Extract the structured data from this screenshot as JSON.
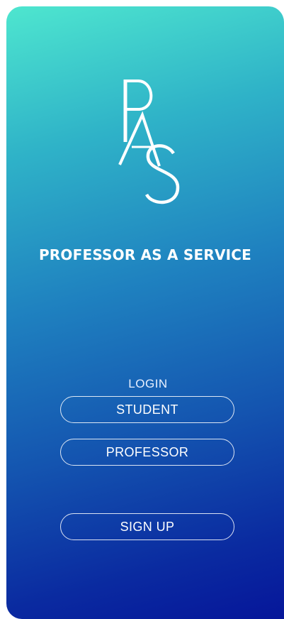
{
  "logo": {
    "letters": "PAS"
  },
  "app_title": "PROFESSOR AS A SERVICE",
  "login": {
    "label": "LOGIN",
    "student_label": "STUDENT",
    "professor_label": "PROFESSOR"
  },
  "signup_label": "SIGN UP",
  "colors": {
    "gradient_top": "#4ee6cf",
    "gradient_bottom": "#06169a",
    "text": "#ffffff"
  }
}
